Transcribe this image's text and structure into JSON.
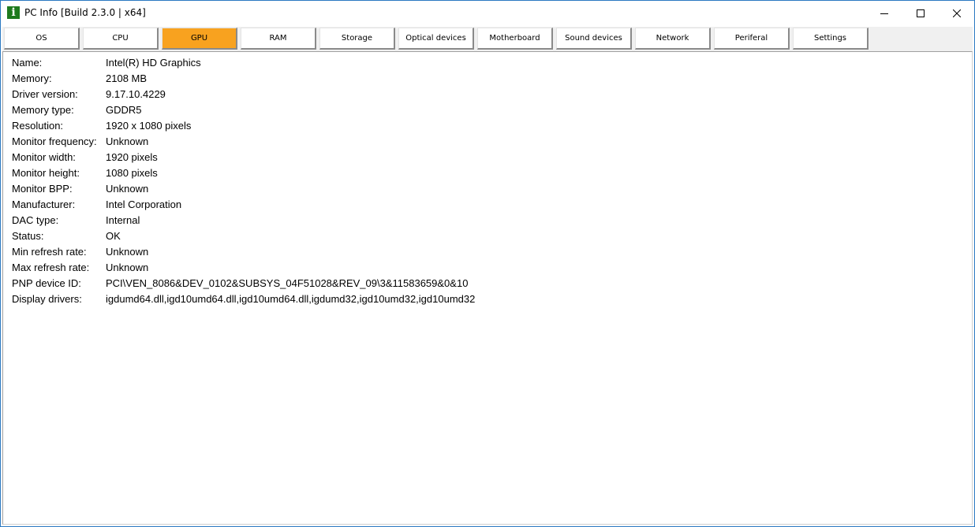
{
  "window": {
    "title": "PC Info [Build 2.3.0 | x64]",
    "icon": "info-icon",
    "controls": [
      "minimize-icon",
      "maximize-icon",
      "close-icon"
    ]
  },
  "tabs": [
    {
      "label": "OS"
    },
    {
      "label": "CPU"
    },
    {
      "label": "GPU",
      "active": true
    },
    {
      "label": "RAM"
    },
    {
      "label": "Storage"
    },
    {
      "label": "Optical devices"
    },
    {
      "label": "Motherboard"
    },
    {
      "label": "Sound devices"
    },
    {
      "label": "Network"
    },
    {
      "label": "Periferal"
    },
    {
      "label": "Settings"
    }
  ],
  "colors": {
    "active_tab": "#f8a21f",
    "window_border": "#2b79c2"
  },
  "gpu": {
    "rows": [
      {
        "label": "Name:",
        "value": "Intel(R) HD Graphics"
      },
      {
        "label": "Memory:",
        "value": "2108 MB"
      },
      {
        "label": "Driver version:",
        "value": "9.17.10.4229"
      },
      {
        "label": "Memory type:",
        "value": "GDDR5"
      },
      {
        "label": "Resolution:",
        "value": "1920 x 1080 pixels"
      },
      {
        "label": "Monitor frequency:",
        "value": "Unknown"
      },
      {
        "label": "Monitor width:",
        "value": "1920 pixels"
      },
      {
        "label": "Monitor height:",
        "value": "1080 pixels"
      },
      {
        "label": "Monitor BPP:",
        "value": "Unknown"
      },
      {
        "label": "Manufacturer:",
        "value": "Intel Corporation"
      },
      {
        "label": "DAC type:",
        "value": "Internal"
      },
      {
        "label": "Status:",
        "value": "OK"
      },
      {
        "label": "Min refresh rate:",
        "value": "Unknown"
      },
      {
        "label": "Max refresh rate:",
        "value": "Unknown"
      },
      {
        "label": "PNP device ID:",
        "value": "PCI\\VEN_8086&DEV_0102&SUBSYS_04F51028&REV_09\\3&11583659&0&10"
      },
      {
        "label": "Display drivers:",
        "value": "igdumd64.dll,igd10umd64.dll,igd10umd64.dll,igdumd32,igd10umd32,igd10umd32"
      }
    ]
  }
}
